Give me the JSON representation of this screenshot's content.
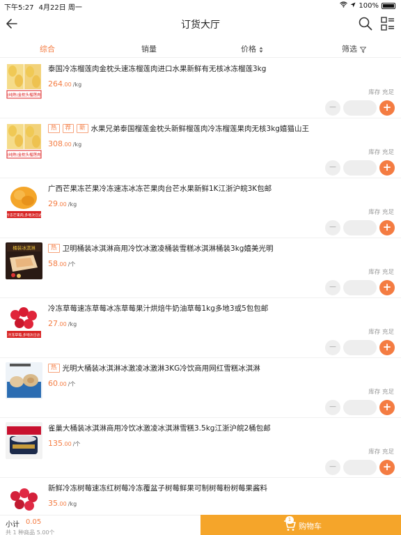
{
  "status_bar": {
    "time": "下午5:27",
    "date": "4月22日 周一",
    "battery": "100%"
  },
  "nav": {
    "title": "订货大厅"
  },
  "tabs": {
    "comprehensive": "综合",
    "sales": "销量",
    "price": "价格",
    "price_sort_icon": "sort-arrows-icon",
    "filter": "筛选",
    "filter_icon": "funnel-icon"
  },
  "products": [
    {
      "tags": [],
      "name": "泰国冷冻榴莲肉金枕头速冻榴莲肉进口水果新鲜有无核冰冻榴莲3kg",
      "price_int": "264",
      "price_dec": ".00",
      "unit": "/kg",
      "stock": "库存 充足"
    },
    {
      "tags": [
        "热",
        "荐",
        "新"
      ],
      "name": "水果兄弟泰国榴莲金枕头新鲜榴莲肉冷冻榴莲果肉无核3kg嬉猫山王",
      "price_int": "308",
      "price_dec": ".00",
      "unit": "/kg",
      "stock": "库存 充足"
    },
    {
      "tags": [],
      "name": "广西芒果冻芒果冷冻速冻冰冻芒果肉台芒水果新鲜1K江浙沪皖3K包邮",
      "price_int": "29",
      "price_dec": ".00",
      "unit": "/kg",
      "stock": "库存 充足"
    },
    {
      "tags": [
        "热"
      ],
      "name": "卫明桶装冰淇淋商用冷饮冰激凌桶装雪糕冰淇淋桶装3kg嬉美光明",
      "price_int": "58",
      "price_dec": ".00",
      "unit": "/个",
      "stock": "库存 充足"
    },
    {
      "tags": [],
      "name": "冷冻草莓速冻草莓冰冻草莓果汁烘焙牛奶油草莓1kg多地3或5包包邮",
      "price_int": "27",
      "price_dec": ".00",
      "unit": "/kg",
      "stock": "库存 充足"
    },
    {
      "tags": [
        "热"
      ],
      "name": "光明大桶装冰淇淋冰激凌冰激淋3KG冷饮商用网红雪糕冰淇淋",
      "price_int": "60",
      "price_dec": ".00",
      "unit": "/个",
      "stock": "库存 充足"
    },
    {
      "tags": [],
      "name": "雀巢大桶装冰淇淋商用冷饮冰激凌冰淇淋雪糕3.5kg江浙沪皖2桶包邮",
      "price_int": "135",
      "price_dec": ".00",
      "unit": "/个",
      "stock": "库存 充足"
    },
    {
      "tags": [],
      "name": "新鲜冷冻树莓速冻红树莓冷冻覆盆子树莓鲜果可制树莓粉树莓果酱料",
      "price_int": "35",
      "price_dec": ".00",
      "unit": "/kg",
      "stock": ""
    }
  ],
  "thumb_captions": {
    "durian": "(纯熟)金枕头榴莲肉",
    "mango": "冷冻芒果肉,多地次日达",
    "icecream": "桶装冰淇淋",
    "strawberry": "冷冻草莓,多地次日达"
  },
  "footer": {
    "subtotal_label": "小计",
    "subtotal_amount": "0.05",
    "meta": "共 1 种商品 5.00个",
    "cart_label": "购物车",
    "cart_badge": "1"
  },
  "colors": {
    "accent": "#f47c42",
    "cart_bg": "#f5a52a"
  }
}
